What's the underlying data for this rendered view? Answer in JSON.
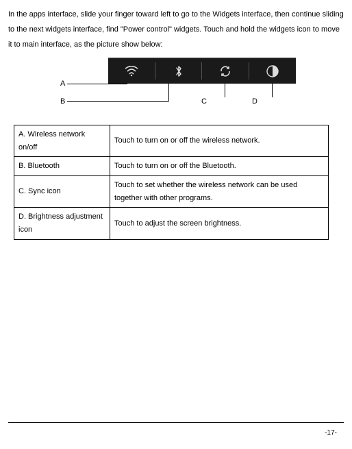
{
  "intro": "In the apps interface, slide your finger toward left to go to the Widgets interface, then continue sliding to the next widgets interface, find \"Power control\" widgets. Touch and hold the widgets icon to move it to main interface, as the picture show below:",
  "labels": {
    "a": "A",
    "b": "B",
    "c": "C",
    "d": "D"
  },
  "icons": {
    "wifi": "wifi-icon",
    "bluetooth": "bluetooth-icon",
    "sync": "sync-icon",
    "brightness": "brightness-icon"
  },
  "table": {
    "rows": [
      {
        "label": "A. Wireless network on/off",
        "desc": "Touch to turn on or off the wireless network."
      },
      {
        "label": "B. Bluetooth",
        "desc": "Touch to turn on or off the Bluetooth."
      },
      {
        "label": "C. Sync icon",
        "desc": "Touch to set whether the wireless network can be used together with other programs."
      },
      {
        "label": "D. Brightness adjustment icon",
        "desc": "Touch to adjust the screen brightness."
      }
    ]
  },
  "page": "-17-"
}
